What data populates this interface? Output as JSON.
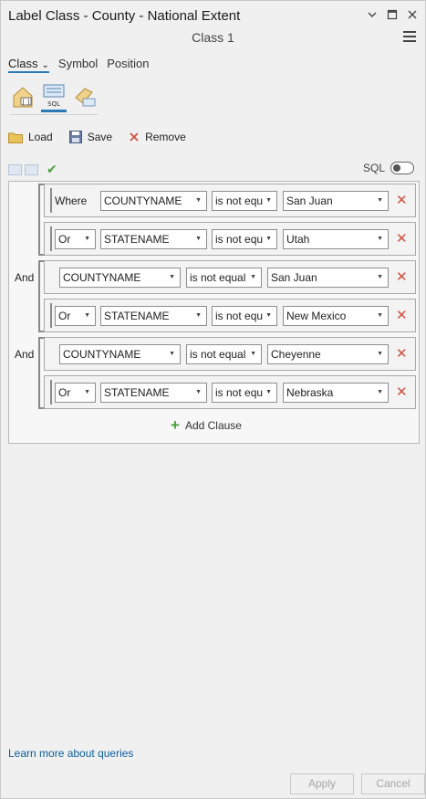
{
  "window": {
    "title": "Label Class - County - National Extent",
    "subtitle": "Class 1"
  },
  "tabs": [
    {
      "label": "Class",
      "active": true,
      "has_dropdown": true
    },
    {
      "label": "Symbol",
      "active": false
    },
    {
      "label": "Position",
      "active": false
    }
  ],
  "icons": {
    "selected_label": "SQL"
  },
  "actions": {
    "load": "Load",
    "save": "Save",
    "remove": "Remove"
  },
  "sql_toggle": {
    "label": "SQL",
    "on": false
  },
  "clauses": [
    {
      "connector": "Where",
      "field": "COUNTYNAME",
      "operator": "is not equ",
      "value": "San Juan"
    },
    {
      "connector": "Or",
      "field": "STATENAME",
      "operator": "is not equ",
      "value": "Utah"
    },
    {
      "group_connector": "And",
      "field": "COUNTYNAME",
      "operator": "is not equal",
      "value": "San Juan"
    },
    {
      "connector": "Or",
      "field": "STATENAME",
      "operator": "is not equ",
      "value": "New Mexico"
    },
    {
      "group_connector": "And",
      "field": "COUNTYNAME",
      "operator": "is not equal",
      "value": "Cheyenne"
    },
    {
      "connector": "Or",
      "field": "STATENAME",
      "operator": "is not equ",
      "value": "Nebraska"
    }
  ],
  "add_clause_label": "Add Clause",
  "learn_more": "Learn more about queries",
  "footer": {
    "apply": "Apply",
    "cancel": "Cancel"
  },
  "colors": {
    "accent": "#2a7ab8",
    "remove_x": "#d14f3e",
    "add_plus": "#4ca23e",
    "link": "#0a5f9e"
  }
}
